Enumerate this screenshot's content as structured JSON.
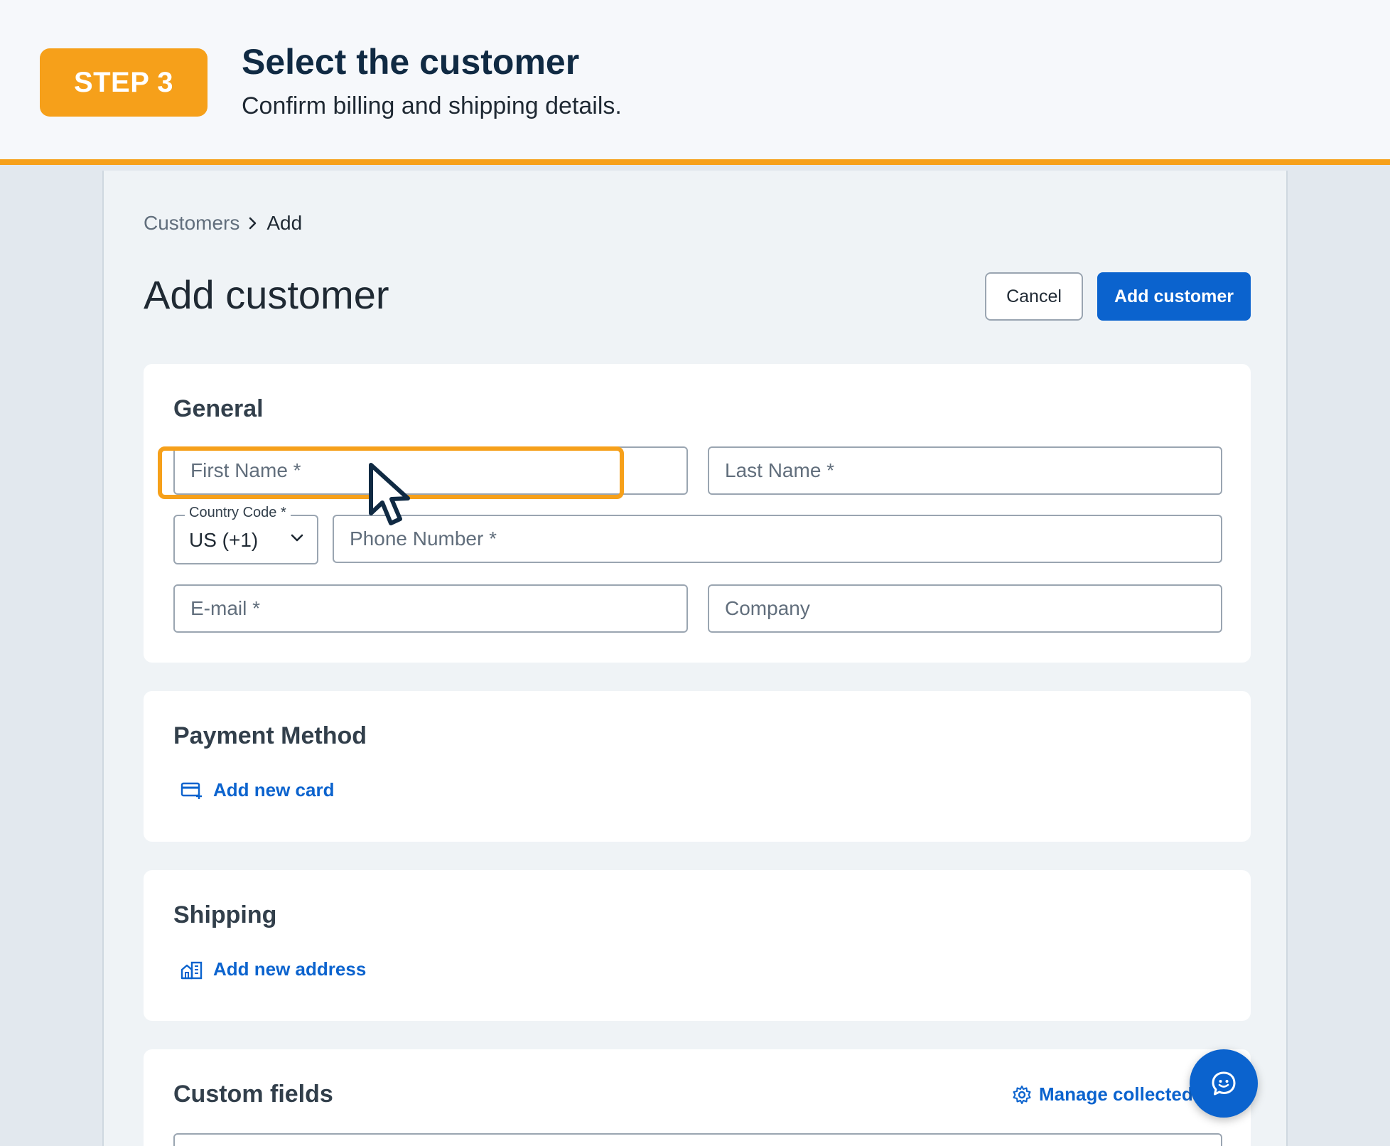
{
  "step": {
    "badge": "STEP 3",
    "title": "Select the customer",
    "subtitle": "Confirm billing and shipping details.",
    "accent_color": "#f6a01a"
  },
  "breadcrumb": {
    "parent": "Customers",
    "separator_icon": "chevron-right-icon",
    "current": "Add"
  },
  "page": {
    "title": "Add customer",
    "cancel_label": "Cancel",
    "submit_label": "Add customer",
    "primary_color": "#0b63ce"
  },
  "general": {
    "title": "General",
    "first_name_placeholder": "First Name *",
    "last_name_placeholder": "Last Name *",
    "country_code_label": "Country Code *",
    "country_code_value": "US (+1)",
    "phone_placeholder": "Phone Number *",
    "email_placeholder": "E-mail *",
    "company_placeholder": "Company"
  },
  "payment": {
    "title": "Payment Method",
    "add_card_label": "Add new card",
    "add_card_icon": "credit-card-plus-icon"
  },
  "shipping": {
    "title": "Shipping",
    "add_address_label": "Add new address",
    "add_address_icon": "building-icon"
  },
  "custom_fields": {
    "title": "Custom fields",
    "manage_label": "Manage collected d",
    "manage_icon": "gear-icon"
  },
  "chat": {
    "icon": "chat-bubble-icon"
  }
}
